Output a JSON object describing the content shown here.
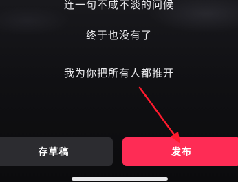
{
  "lyrics": {
    "line1": "连一句不咸不淡的问候",
    "line2": "终于也没有了",
    "line3": "我为你把所有人都推开"
  },
  "actions": {
    "draft_label": "存草稿",
    "publish_label": "发布"
  },
  "colors": {
    "publish_button": "#fe2c55",
    "draft_button": "#2c2c30",
    "annotation_arrow": "#ff1a2e"
  }
}
